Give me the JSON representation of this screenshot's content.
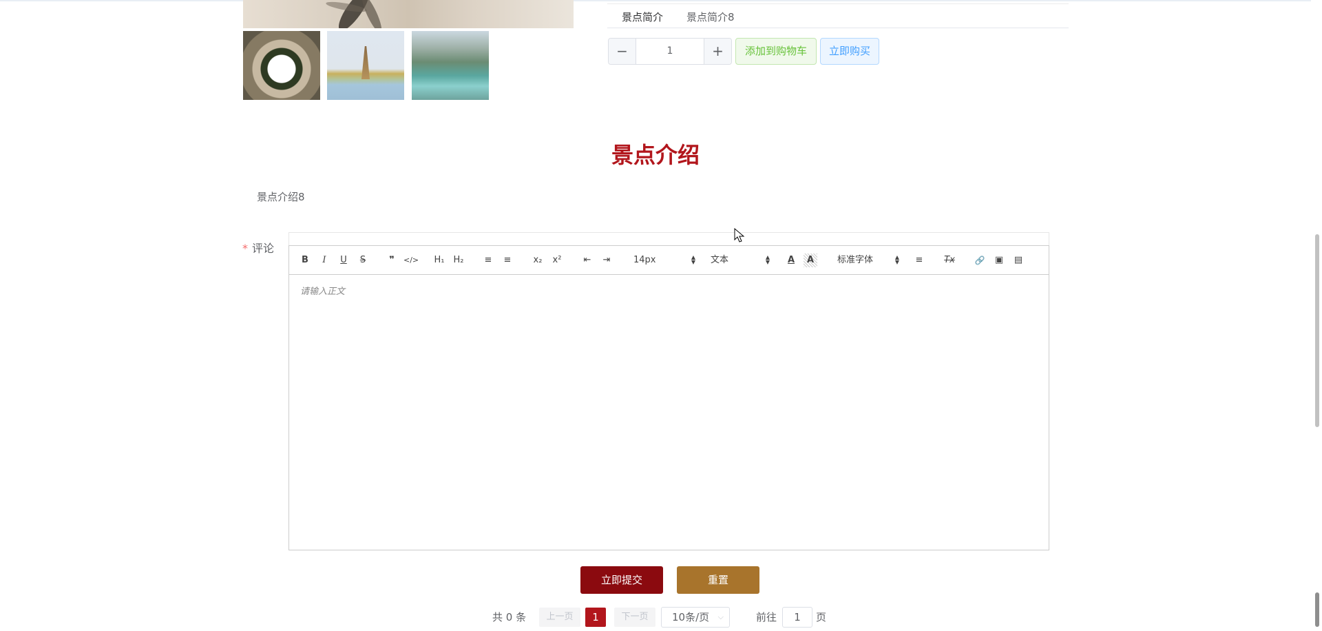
{
  "tabs": [
    {
      "label": "景点简介"
    },
    {
      "label": "景点简介8"
    }
  ],
  "product": {
    "quantity": "1",
    "minus_label": "−",
    "plus_label": "+",
    "add_to_cart_label": "添加到购物车",
    "buy_now_label": "立即购买"
  },
  "section": {
    "title": "景点介绍",
    "intro_text": "景点介绍8"
  },
  "comment": {
    "required_mark": "*",
    "label": "评论",
    "placeholder": "请输入正文"
  },
  "editor_toolbar": {
    "bold": "B",
    "italic": "I",
    "underline": "U",
    "strike": "S",
    "quote": "❞",
    "code": "</>",
    "h1": "H₁",
    "h2": "H₂",
    "ordered_list": "≡",
    "bullet_list": "≡",
    "subscript": "x₂",
    "superscript": "x²",
    "outdent": "⇤",
    "indent": "⇥",
    "font_size": "14px",
    "block_type": "文本",
    "font_color": "A",
    "bg_color": "A",
    "font_family": "标准字体",
    "align": "≡",
    "clear_format": "Tx",
    "link": "🔗",
    "image": "▣",
    "video": "▤"
  },
  "actions": {
    "submit_label": "立即提交",
    "reset_label": "重置"
  },
  "pagination": {
    "total": "共 0 条",
    "prev_label": "上一页",
    "current_page": "1",
    "next_label": "下一页",
    "page_size": "10条/页",
    "goto_label": "前往",
    "jump_value": "1",
    "page_suffix": "页"
  },
  "colors": {
    "brand_red": "#b2161c",
    "submit_bg": "#8b0a0f",
    "reset_bg": "#a8742c",
    "cart_green": "#67c23a",
    "buy_blue": "#409eff"
  }
}
